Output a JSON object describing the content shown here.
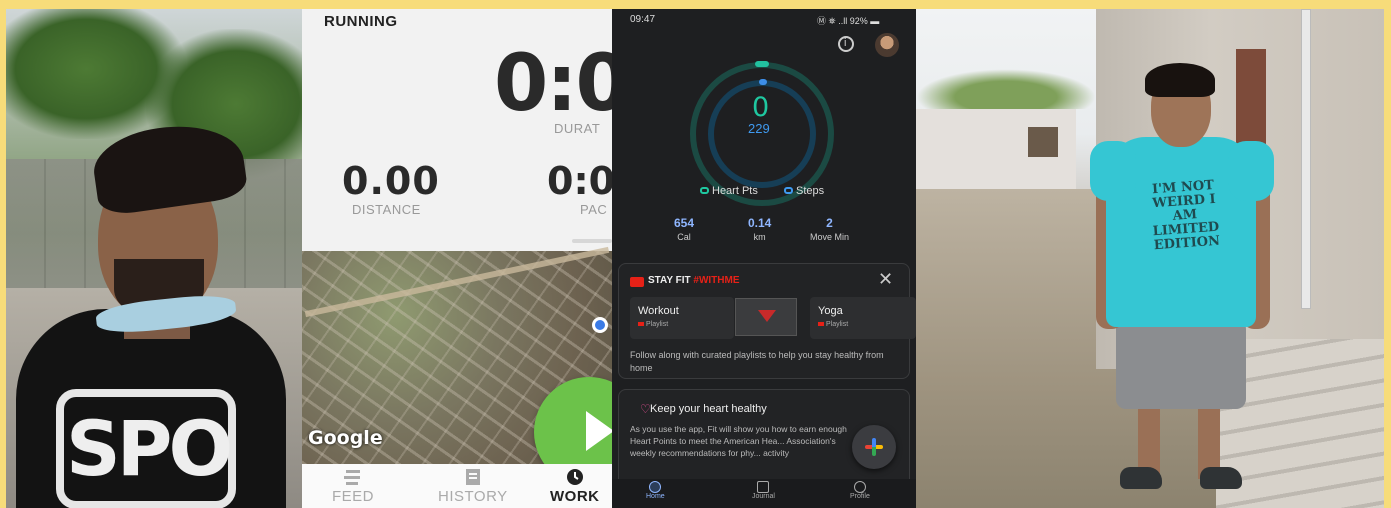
{
  "running_app": {
    "mode_label": "RUNNING",
    "duration_value": "0:0",
    "duration_label": "DURAT",
    "distance_value": "0.00",
    "distance_label": "DISTANCE",
    "pace_value": "0:0",
    "pace_label": "PAC",
    "map_attribution": "Google",
    "nav": [
      {
        "label": "FEED",
        "icon": "feed-icon"
      },
      {
        "label": "HISTORY",
        "icon": "history-icon"
      },
      {
        "label": "WORK",
        "icon": "workout-icon"
      }
    ]
  },
  "fit_app": {
    "status_time": "09:47",
    "status_icons": "Ⓜ ⛯ ..ll 92% ▬",
    "heart_points_value": "0",
    "steps_value": "229",
    "legend_heart": "Heart Pts",
    "legend_steps": "Steps",
    "stats": [
      {
        "value": "654",
        "label": "Cal"
      },
      {
        "value": "0.14",
        "label": "km"
      },
      {
        "value": "2",
        "label": "Move Min"
      }
    ],
    "stayfit_card": {
      "brand_prefix": "STAY FIT",
      "brand_suffix": "#WITHME",
      "workout_title": "Workout",
      "workout_sub": "Playlist",
      "yoga_title": "Yoga",
      "yoga_sub": "Playlist",
      "description": "Follow along with curated playlists to help you stay healthy from home"
    },
    "heart_card": {
      "title": "Keep your heart healthy",
      "description": "As you use the app, Fit will show you how to earn enough Heart Points to meet the American Hea... Association's weekly recommendations for phy... activity"
    },
    "bottom_nav": [
      {
        "label": "Home"
      },
      {
        "label": "Journal"
      },
      {
        "label": "Profile"
      }
    ]
  },
  "photo_left": {
    "shirt_print": "SPO"
  },
  "photo_right": {
    "tshirt_text": "I'M NOT WEIRD I AM LIMITED EDITION"
  },
  "colors": {
    "background": "#f7dc7a",
    "fit_heart": "#1fc7a0",
    "fit_steps": "#3f9af0",
    "play_button": "#6cc24a"
  }
}
